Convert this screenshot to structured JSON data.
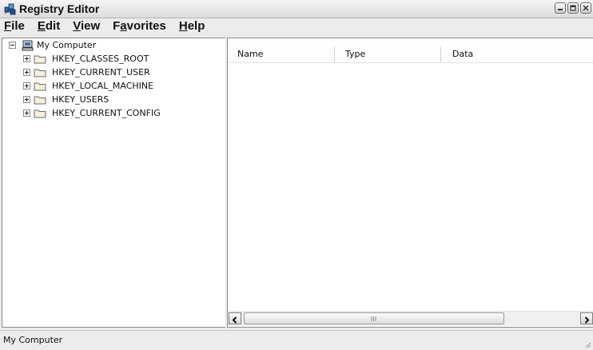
{
  "window": {
    "title": "Registry Editor",
    "app_icon": "registry-editor-icon",
    "controls": [
      {
        "name": "minimize",
        "icon": "minimize-icon"
      },
      {
        "name": "maximize",
        "icon": "maximize-icon"
      },
      {
        "name": "close",
        "icon": "close-icon"
      }
    ]
  },
  "menu": {
    "items": [
      {
        "label": "File",
        "hotkey": "F"
      },
      {
        "label": "Edit",
        "hotkey": "E"
      },
      {
        "label": "View",
        "hotkey": "V"
      },
      {
        "label": "Favorites",
        "hotkey": "a"
      },
      {
        "label": "Help",
        "hotkey": "H"
      }
    ]
  },
  "tree": {
    "root": {
      "label": "My Computer",
      "icon": "computer-icon",
      "expanded": true
    },
    "children": [
      {
        "label": "HKEY_CLASSES_ROOT",
        "icon": "folder-icon",
        "expanded": false
      },
      {
        "label": "HKEY_CURRENT_USER",
        "icon": "folder-icon",
        "expanded": false
      },
      {
        "label": "HKEY_LOCAL_MACHINE",
        "icon": "folder-icon",
        "expanded": false
      },
      {
        "label": "HKEY_USERS",
        "icon": "folder-icon",
        "expanded": false
      },
      {
        "label": "HKEY_CURRENT_CONFIG",
        "icon": "folder-icon",
        "expanded": false
      }
    ]
  },
  "list": {
    "columns": [
      "Name",
      "Type",
      "Data"
    ],
    "rows": []
  },
  "scrollbar": {
    "left_arrow": "scroll-left-icon",
    "right_arrow": "scroll-right-icon"
  },
  "status": {
    "text": "My Computer"
  },
  "colors": {
    "window_bg": "#ececec",
    "pane_bg": "#ffffff",
    "border": "#8c8c8c",
    "folder": "#d8c97a"
  }
}
